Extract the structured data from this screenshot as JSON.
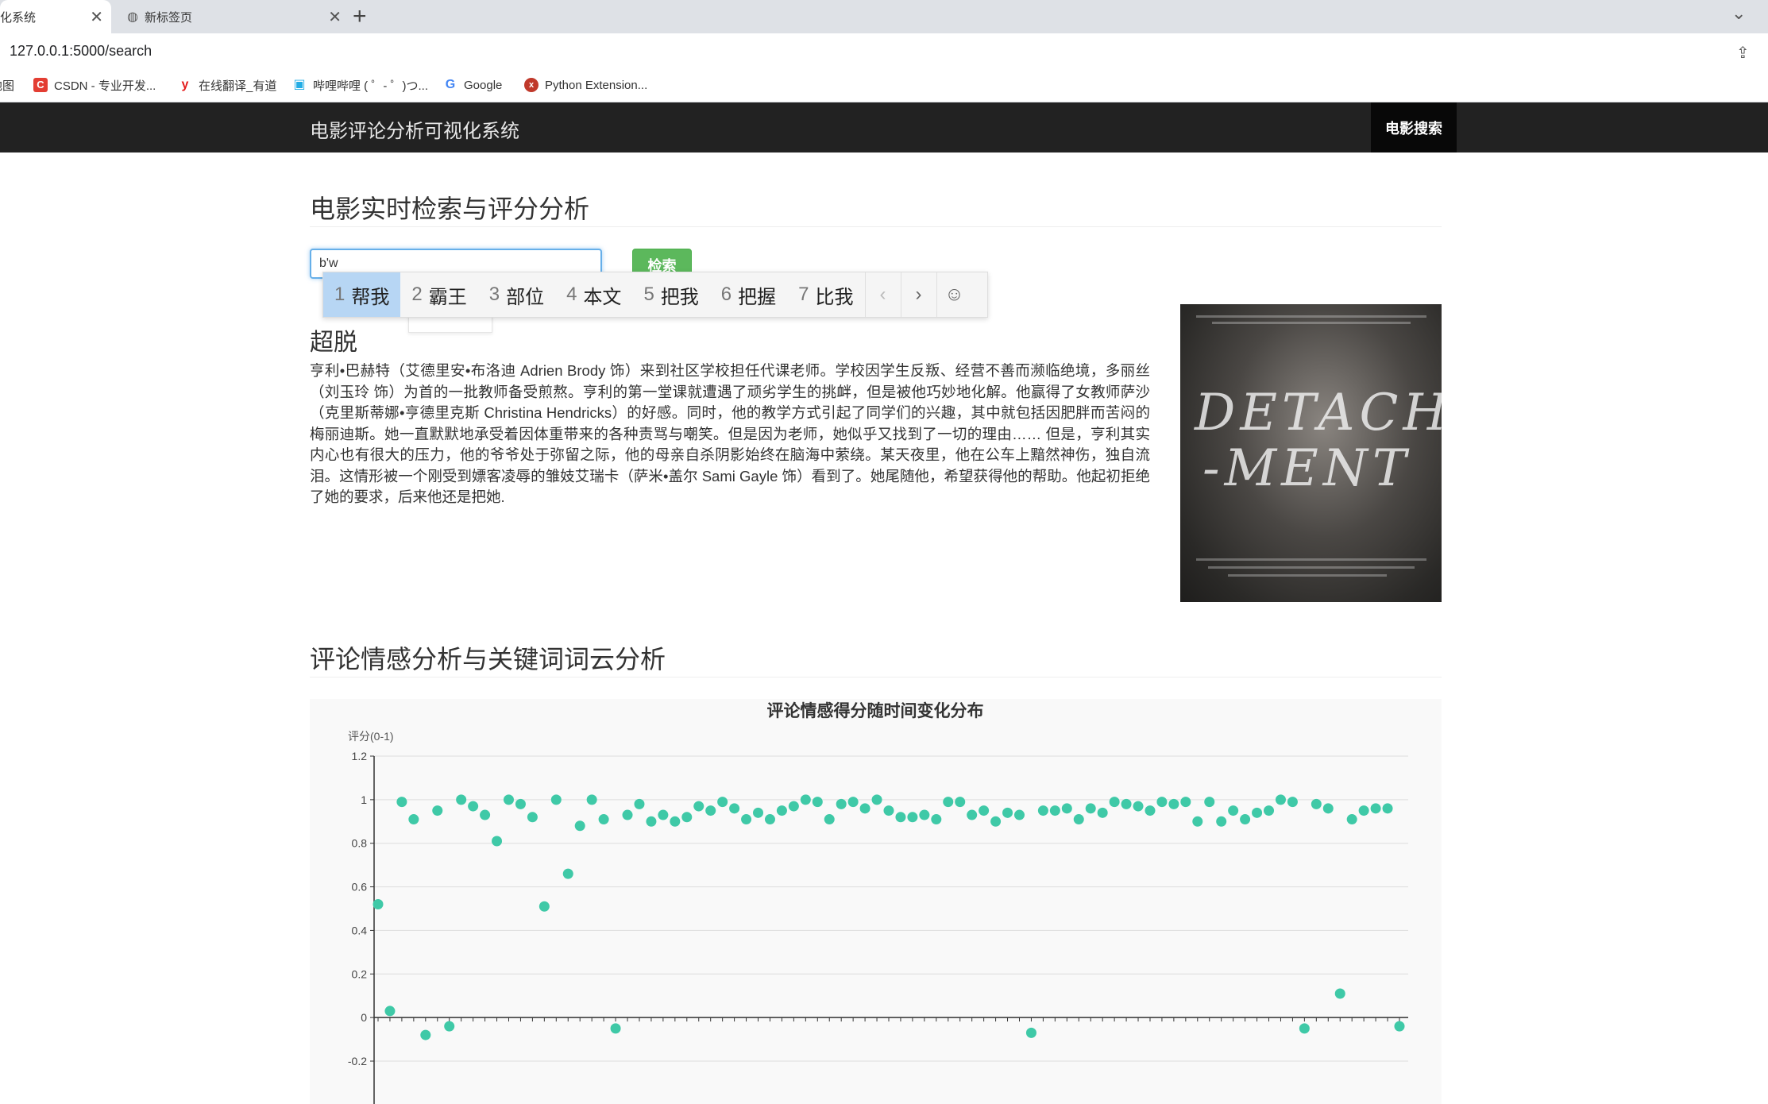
{
  "browser": {
    "tabs": [
      {
        "title": "化系统",
        "active": true
      },
      {
        "title": "新标签页",
        "active": false
      }
    ],
    "url": "127.0.0.1:5000/search",
    "bookmarks": [
      {
        "label": "地图",
        "icon": "map-icon",
        "color": "#ffffff"
      },
      {
        "label": "CSDN - 专业开发...",
        "icon": "csdn-icon",
        "color": "#e33e33"
      },
      {
        "label": "在线翻译_有道",
        "icon": "youdao-icon",
        "color": "#e31b1b"
      },
      {
        "label": "哔哩哔哩 ( ゜- ゜)つ...",
        "icon": "bilibili-icon",
        "color": "#23ade5"
      },
      {
        "label": "Google",
        "icon": "google-icon",
        "color": "#4285f4"
      },
      {
        "label": "Python Extension...",
        "icon": "python-ext-icon",
        "color": "#c0392b"
      }
    ]
  },
  "navbar": {
    "brand": "电影评论分析可视化系统",
    "search_link": "电影搜索"
  },
  "search_section": {
    "heading": "电影实时检索与评分分析",
    "input_value": "b'w",
    "button_label": "检索"
  },
  "ime": {
    "candidates": [
      {
        "num": "1",
        "text": "帮我"
      },
      {
        "num": "2",
        "text": "霸王"
      },
      {
        "num": "3",
        "text": "部位"
      },
      {
        "num": "4",
        "text": "本文"
      },
      {
        "num": "5",
        "text": "把我"
      },
      {
        "num": "6",
        "text": "把握"
      },
      {
        "num": "7",
        "text": "比我"
      }
    ]
  },
  "movie": {
    "title": "超脱",
    "description": "亨利•巴赫特（艾德里安•布洛迪 Adrien Brody 饰）来到社区学校担任代课老师。学校因学生反叛、经营不善而濒临绝境，多丽丝（刘玉玲 饰）为首的一批教师备受煎熬。亨利的第一堂课就遭遇了顽劣学生的挑衅，但是被他巧妙地化解。他赢得了女教师萨沙（克里斯蒂娜•亨德里克斯 Christina Hendricks）的好感。同时，他的教学方式引起了同学们的兴趣，其中就包括因肥胖而苦闷的梅丽迪斯。她一直默默地承受着因体重带来的各种责骂与嘲笑。但是因为老师，她似乎又找到了一切的理由…… 但是，亨利其实内心也有很大的压力，他的爷爷处于弥留之际，他的母亲自杀阴影始终在脑海中萦绕。某天夜里，他在公车上黯然神伤，独自流泪。这情形被一个刚受到嫖客凌辱的雏妓艾瑞卡（萨米•盖尔 Sami Gayle 饰）看到了。她尾随他，希望获得他的帮助。他起初拒绝了她的要求，后来他还是把她.",
    "poster_text": [
      "DETACH",
      "-MENT"
    ]
  },
  "analysis_section": {
    "heading": "评论情感分析与关键词词云分析"
  },
  "chart_data": {
    "type": "scatter",
    "title": "评论情感得分随时间变化分布",
    "ylabel": "评分(0-1)",
    "ylim": [
      -0.2,
      1.2
    ],
    "yticks": [
      "1.2",
      "1",
      "0.8",
      "0.6",
      "0.4",
      "0.2",
      "0",
      "-0.2"
    ],
    "grid": true,
    "color": "#3fc9a7",
    "values": [
      0.52,
      0.03,
      0.99,
      0.91,
      -0.08,
      0.95,
      -0.04,
      1.0,
      0.97,
      0.93,
      0.81,
      1.0,
      0.98,
      0.92,
      0.51,
      1.0,
      0.66,
      0.88,
      1.0,
      0.91,
      -0.05,
      0.93,
      0.98,
      0.9,
      0.93,
      0.9,
      0.92,
      0.97,
      0.95,
      0.99,
      0.96,
      0.91,
      0.94,
      0.91,
      0.95,
      0.97,
      1.0,
      0.99,
      0.91,
      0.98,
      0.99,
      0.96,
      1.0,
      0.95,
      0.92,
      0.92,
      0.93,
      0.91,
      0.99,
      0.99,
      0.93,
      0.95,
      0.9,
      0.94,
      0.93,
      -0.07,
      0.95,
      0.95,
      0.96,
      0.91,
      0.96,
      0.94,
      0.99,
      0.98,
      0.97,
      0.95,
      0.99,
      0.98,
      0.99,
      0.9,
      0.99,
      0.9,
      0.95,
      0.91,
      0.94,
      0.95,
      1.0,
      0.99,
      -0.05,
      0.98,
      0.96,
      0.11,
      0.91,
      0.95,
      0.96,
      0.96,
      -0.04
    ]
  }
}
